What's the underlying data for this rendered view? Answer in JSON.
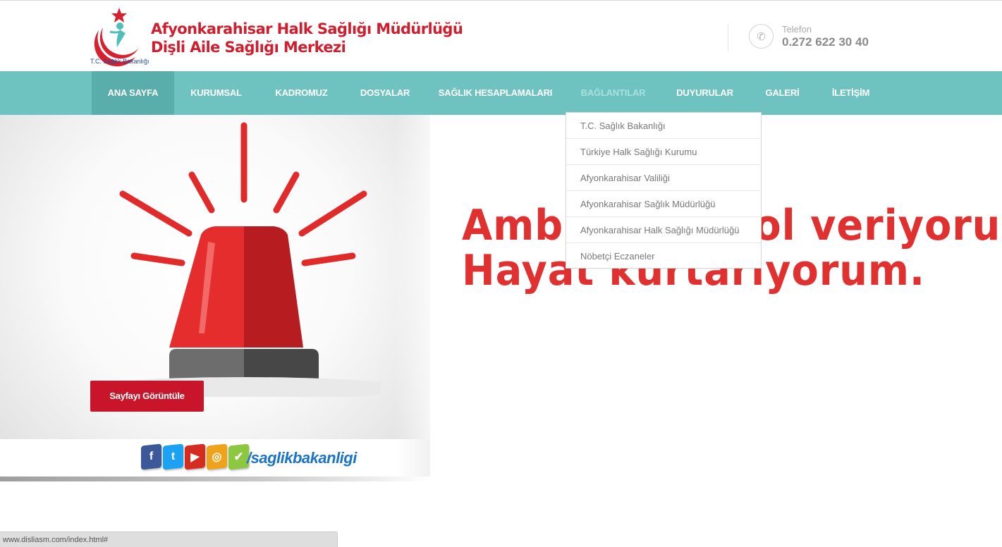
{
  "header": {
    "org_title_line1": "Afyonkarahisar Halk Sağlığı Müdürlüğü",
    "org_title_line2": "Dişli Aile Sağlığı Merkezi",
    "ministry_label": "T.C. Sağlık Bakanlığı",
    "phone_label": "Telefon",
    "phone_number": "0.272 622 30 40"
  },
  "nav": {
    "items": [
      {
        "label": "ANA SAYFA",
        "state": "active"
      },
      {
        "label": "KURUMSAL"
      },
      {
        "label": "KADROMUZ"
      },
      {
        "label": "DOSYALAR"
      },
      {
        "label": "SAĞLIK HESAPLAMALARI"
      },
      {
        "label": "BAĞLANTILAR",
        "state": "hover"
      },
      {
        "label": "DUYURULAR"
      },
      {
        "label": "GALERİ"
      },
      {
        "label": "İLETİŞİM"
      }
    ]
  },
  "dropdown": {
    "items": [
      "T.C. Sağlık Bakanlığı",
      "Türkiye Halk Sağlığı Kurumu",
      "Afyonkarahisar Valiliği",
      "Afyonkarahisar Sağlık Müdürlüğü",
      "Afyonkarahisar Halk Sağlığı Müdürlüğü",
      "Nöbetçi Eczaneler"
    ]
  },
  "hero": {
    "slogan_line1": "Ambulansa yol veriyorum,",
    "slogan_line2": "Hayat kurtarıyorum.",
    "button_label": "Sayfayı Görüntüle",
    "social_handle": "/saglikbakanligi",
    "social_icons": [
      {
        "icon": "facebook-icon",
        "glyph": "f",
        "color": "#3b5998"
      },
      {
        "icon": "twitter-icon",
        "glyph": "t",
        "color": "#1da1f2"
      },
      {
        "icon": "youtube-icon",
        "glyph": "▶",
        "color": "#d62b1f"
      },
      {
        "icon": "instagram-icon",
        "glyph": "◎",
        "color": "#f0a21a"
      },
      {
        "icon": "check-icon",
        "glyph": "✔",
        "color": "#8dc63f"
      }
    ]
  },
  "status_bar": {
    "url": "www.disliasm.com/index.html#"
  },
  "colors": {
    "accent": "#6ec3c0",
    "accent_active": "#59adab",
    "brand_red": "#cf1f2e",
    "button_red": "#c9152a"
  }
}
